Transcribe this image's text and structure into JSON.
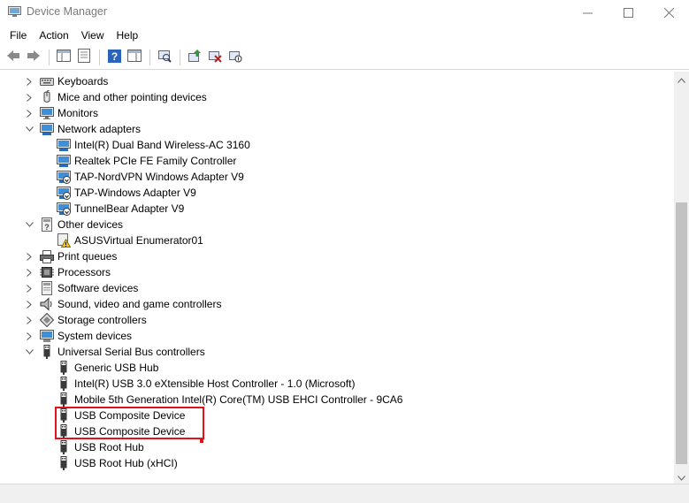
{
  "window": {
    "title": "Device Manager",
    "minimize_icon": "minimize-icon",
    "maximize_icon": "maximize-icon",
    "close_icon": "close-icon"
  },
  "menu": [
    "File",
    "Action",
    "View",
    "Help"
  ],
  "toolbar": {
    "buttons": [
      "back-icon",
      "forward-icon",
      "show-hide-console-tree-icon",
      "properties-icon",
      "help-icon",
      "show-hide-action-pane-icon",
      "scan-hardware-changes-icon",
      "update-driver-icon",
      "uninstall-device-icon",
      "disable-device-icon"
    ]
  },
  "tree": {
    "rows": [
      {
        "level": 0,
        "expander": "collapsed",
        "icon": "keyboard-icon",
        "label": "Keyboards"
      },
      {
        "level": 0,
        "expander": "collapsed",
        "icon": "mouse-icon",
        "label": "Mice and other pointing devices"
      },
      {
        "level": 0,
        "expander": "collapsed",
        "icon": "monitor-icon",
        "label": "Monitors"
      },
      {
        "level": 0,
        "expander": "expanded",
        "icon": "network-icon",
        "label": "Network adapters"
      },
      {
        "level": 1,
        "expander": "none",
        "icon": "network-adapter-icon",
        "label": "Intel(R) Dual Band Wireless-AC 3160"
      },
      {
        "level": 1,
        "expander": "none",
        "icon": "network-adapter-icon",
        "label": "Realtek PCIe FE Family Controller"
      },
      {
        "level": 1,
        "expander": "none",
        "icon": "network-adapter-disabled-icon",
        "label": "TAP-NordVPN Windows Adapter V9"
      },
      {
        "level": 1,
        "expander": "none",
        "icon": "network-adapter-disabled-icon",
        "label": "TAP-Windows Adapter V9"
      },
      {
        "level": 1,
        "expander": "none",
        "icon": "network-adapter-disabled-icon",
        "label": "TunnelBear Adapter V9"
      },
      {
        "level": 0,
        "expander": "expanded",
        "icon": "other-devices-icon",
        "label": "Other devices"
      },
      {
        "level": 1,
        "expander": "none",
        "icon": "warning-device-icon",
        "label": "ASUSVirtual Enumerator01"
      },
      {
        "level": 0,
        "expander": "collapsed",
        "icon": "printer-icon",
        "label": "Print queues"
      },
      {
        "level": 0,
        "expander": "collapsed",
        "icon": "processor-icon",
        "label": "Processors"
      },
      {
        "level": 0,
        "expander": "collapsed",
        "icon": "software-device-icon",
        "label": "Software devices"
      },
      {
        "level": 0,
        "expander": "collapsed",
        "icon": "speaker-icon",
        "label": "Sound, video and game controllers"
      },
      {
        "level": 0,
        "expander": "collapsed",
        "icon": "storage-icon",
        "label": "Storage controllers"
      },
      {
        "level": 0,
        "expander": "collapsed",
        "icon": "system-devices-icon",
        "label": "System devices"
      },
      {
        "level": 0,
        "expander": "expanded",
        "icon": "usb-icon",
        "label": "Universal Serial Bus controllers"
      },
      {
        "level": 1,
        "expander": "none",
        "icon": "usb-icon",
        "label": "Generic USB Hub"
      },
      {
        "level": 1,
        "expander": "none",
        "icon": "usb-icon",
        "label": "Intel(R) USB 3.0 eXtensible Host Controller - 1.0 (Microsoft)"
      },
      {
        "level": 1,
        "expander": "none",
        "icon": "usb-icon",
        "label": "Mobile 5th Generation Intel(R) Core(TM) USB EHCI Controller - 9CA6"
      },
      {
        "level": 1,
        "expander": "none",
        "icon": "usb-icon",
        "label": "USB Composite Device"
      },
      {
        "level": 1,
        "expander": "none",
        "icon": "usb-icon",
        "label": "USB Composite Device"
      },
      {
        "level": 1,
        "expander": "none",
        "icon": "usb-icon",
        "label": "USB Root Hub"
      },
      {
        "level": 1,
        "expander": "none",
        "icon": "usb-icon",
        "label": "USB Root Hub (xHCI)"
      }
    ]
  },
  "colors": {
    "highlight": "#e0121a",
    "scroll_thumb": "#c2c2c2"
  }
}
